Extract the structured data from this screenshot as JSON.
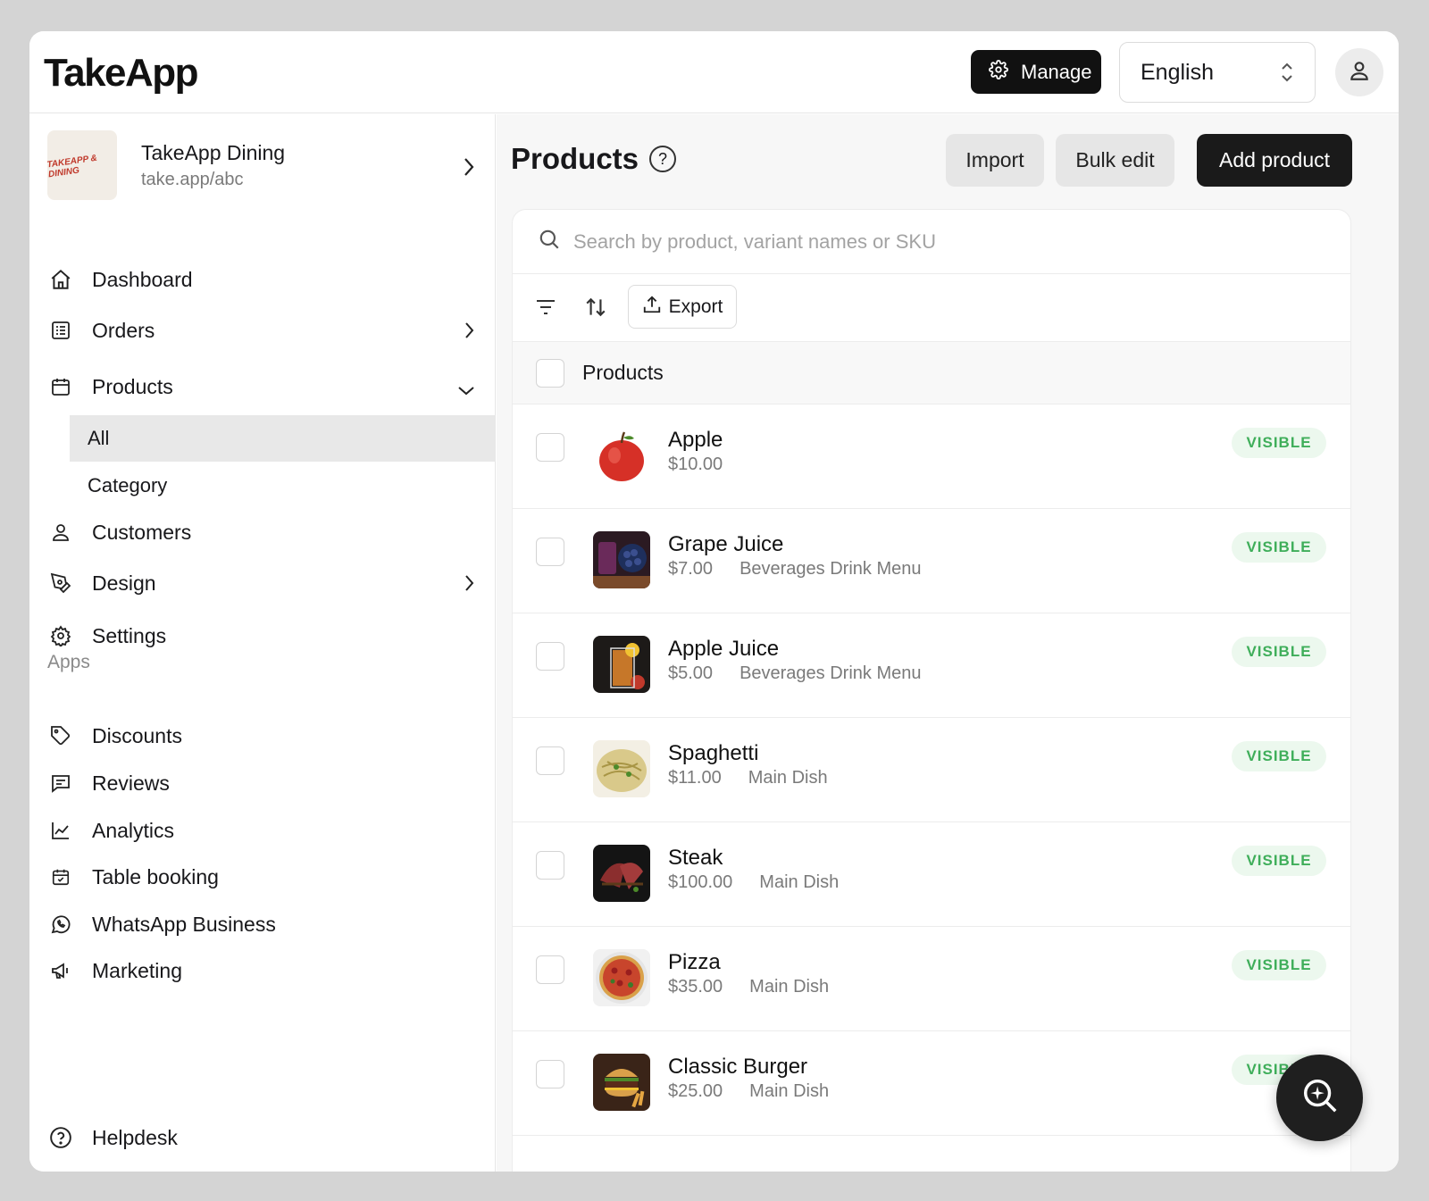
{
  "header": {
    "logo": "TakeApp",
    "manage_label": "Manage",
    "language": "English"
  },
  "store": {
    "name": "TakeApp Dining",
    "url": "take.app/abc",
    "logo_text": "TAKEAPP & DINING"
  },
  "nav": {
    "dashboard": "Dashboard",
    "orders": "Orders",
    "products": "Products",
    "products_all": "All",
    "products_category": "Category",
    "customers": "Customers",
    "design": "Design",
    "settings": "Settings",
    "apps_label": "Apps",
    "discounts": "Discounts",
    "reviews": "Reviews",
    "analytics": "Analytics",
    "table_booking": "Table booking",
    "whatsapp_business": "WhatsApp Business",
    "marketing": "Marketing",
    "helpdesk": "Helpdesk"
  },
  "main": {
    "title": "Products",
    "import_label": "Import",
    "bulk_edit_label": "Bulk edit",
    "add_product_label": "Add product",
    "search_placeholder": "Search by product, variant names or SKU",
    "export_label": "Export",
    "column_header": "Products"
  },
  "products": [
    {
      "name": "Apple",
      "price": "$10.00",
      "category": "",
      "status": "VISIBLE"
    },
    {
      "name": "Grape Juice",
      "price": "$7.00",
      "category": "Beverages Drink Menu",
      "status": "VISIBLE"
    },
    {
      "name": "Apple Juice",
      "price": "$5.00",
      "category": "Beverages Drink Menu",
      "status": "VISIBLE"
    },
    {
      "name": "Spaghetti",
      "price": "$11.00",
      "category": "Main Dish",
      "status": "VISIBLE"
    },
    {
      "name": "Steak",
      "price": "$100.00",
      "category": "Main Dish",
      "status": "VISIBLE"
    },
    {
      "name": "Pizza",
      "price": "$35.00",
      "category": "Main Dish",
      "status": "VISIBLE"
    },
    {
      "name": "Classic Burger",
      "price": "$25.00",
      "category": "Main Dish",
      "status": "VISIBLE"
    }
  ],
  "colors": {
    "accent_dark": "#1a1a1a",
    "visible_badge_text": "#3fae5a",
    "visible_badge_bg": "#ecf8ee"
  }
}
